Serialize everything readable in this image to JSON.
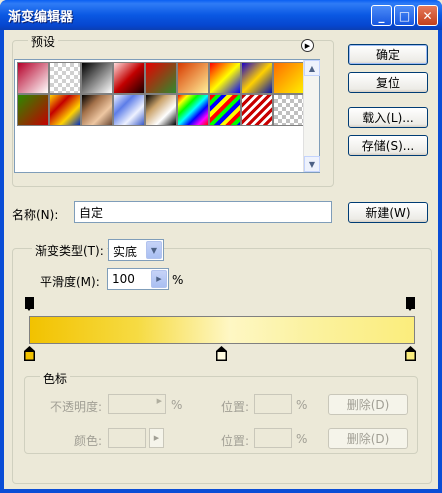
{
  "window": {
    "title": "渐变编辑器"
  },
  "titlebar_buttons": {
    "minimize": "_",
    "maximize": "□",
    "close": "✕"
  },
  "presets": {
    "label": "预设",
    "menu_arrow": "▶",
    "swatches": [
      "linear-gradient(135deg,#b5002a,#ffffff)",
      "repeating-conic-gradient(#d0d0d0 0% 25%, #fff 0% 50%) 0 0/8px 8px, linear-gradient(135deg,#c4003a,transparent)",
      "linear-gradient(135deg,#000,#fff)",
      "linear-gradient(135deg,#ffd9d9,#c20000,#1a0000)",
      "linear-gradient(135deg,#e60000,#2e8b2e)",
      "linear-gradient(135deg,#d83a00,#fff09a)",
      "linear-gradient(135deg,#f00,#ff0,#00f)",
      "linear-gradient(135deg,#1a00c8,#ffd100,#0010b0)",
      "linear-gradient(135deg,#ff6d00,#fff000)",
      "linear-gradient(135deg,#2b8a00,#c30000)",
      "linear-gradient(135deg,#ffd100,#c40000,#ffd100,#0030c0)",
      "linear-gradient(135deg,#000,#a4714a,#eec7a2,#6d4a35)",
      "linear-gradient(135deg,#eef2ff,#5d7de8,#eef2ff,#3a5ac7)",
      "linear-gradient(135deg,#000,#caa26a,#fff,#000)",
      "linear-gradient(135deg,#f00,#ff0,#0f0,#0ff,#00f,#f0f,#f00)",
      "repeating-linear-gradient(135deg,#ff0000 0 4px,#00ff00 4px 8px,#0000ff 8px 12px,#ffff00 12px 16px)",
      "repeating-linear-gradient(135deg,#c80000 0 3px,#fff 3px 6px)",
      "repeating-conic-gradient(#c0c0c0 0% 25%, #fff 0% 50%) 0 0/8px 8px"
    ]
  },
  "buttons": {
    "ok": "确定",
    "reset": "复位",
    "load": "载入(L)...",
    "save": "存储(S)...",
    "new": "新建(W)"
  },
  "name": {
    "label": "名称(N):",
    "value": "自定"
  },
  "gradient": {
    "type_label": "渐变类型(T):",
    "type_value": "实底",
    "smoothness_label": "平滑度(M):",
    "smoothness_value": "100",
    "smoothness_unit": "%",
    "colors": {
      "left": "#f2c200",
      "right": "#fbed7c"
    }
  },
  "stops": {
    "label": "色标",
    "opacity_label": "不透明度:",
    "opacity_unit": "%",
    "opacity_location_label": "位置:",
    "opacity_location_unit": "%",
    "opacity_delete": "删除(D)",
    "color_label": "颜色:",
    "color_location_label": "位置:",
    "color_location_unit": "%",
    "color_delete": "删除(D)"
  }
}
